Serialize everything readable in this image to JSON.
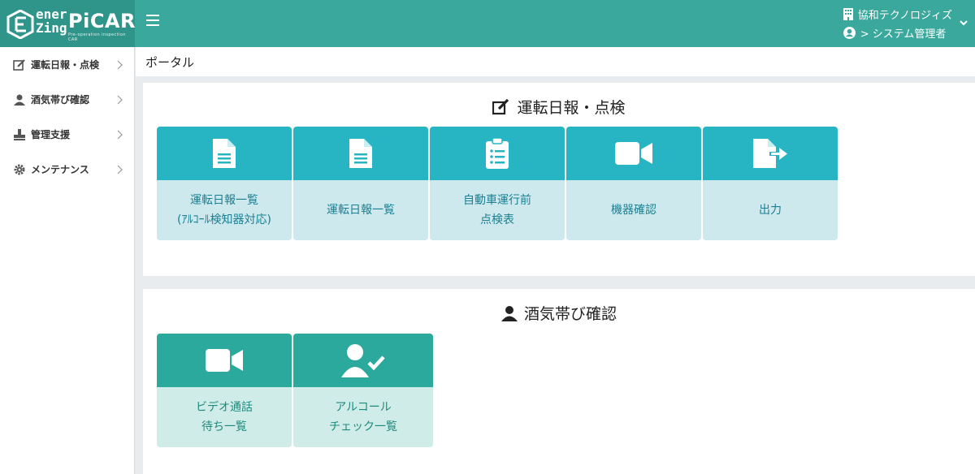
{
  "header": {
    "logo_line1": "ener",
    "logo_line2": "Zing",
    "logo_product": "PiCAR",
    "logo_tagline": "Pre-operation inspection CAR",
    "company": "協和テクノロジィズ",
    "user": "> システム管理者"
  },
  "sidebar": {
    "items": [
      {
        "label": "運転日報・点検",
        "icon": "edit-icon"
      },
      {
        "label": "酒気帯び確認",
        "icon": "user-icon"
      },
      {
        "label": "管理支援",
        "icon": "stamp-icon"
      },
      {
        "label": "メンテナンス",
        "icon": "gear-icon"
      }
    ]
  },
  "breadcrumb": "ポータル",
  "sections": [
    {
      "title": "運転日報・点検",
      "icon": "edit-icon",
      "tiles": [
        {
          "label": "運転日報一覧\n(ｱﾙｺｰﾙ検知器対応)",
          "icon": "document-icon"
        },
        {
          "label": "運転日報一覧",
          "icon": "document-icon"
        },
        {
          "label": "自動車運行前\n点検表",
          "icon": "clipboard-list-icon"
        },
        {
          "label": "機器確認",
          "icon": "video-icon"
        },
        {
          "label": "出力",
          "icon": "file-export-icon"
        }
      ]
    },
    {
      "title": "酒気帯び確認",
      "icon": "user-icon",
      "tiles": [
        {
          "label": "ビデオ通話\n待ち一覧",
          "icon": "video-icon"
        },
        {
          "label": "アルコール\nチェック一覧",
          "icon": "user-check-icon"
        }
      ]
    }
  ],
  "colors": {
    "header": "#3aa89c",
    "tile_blue": "#27b5c3",
    "tile_blue_light": "#cde9ee",
    "tile_green": "#2aa99c",
    "tile_green_light": "#d0ece9"
  }
}
